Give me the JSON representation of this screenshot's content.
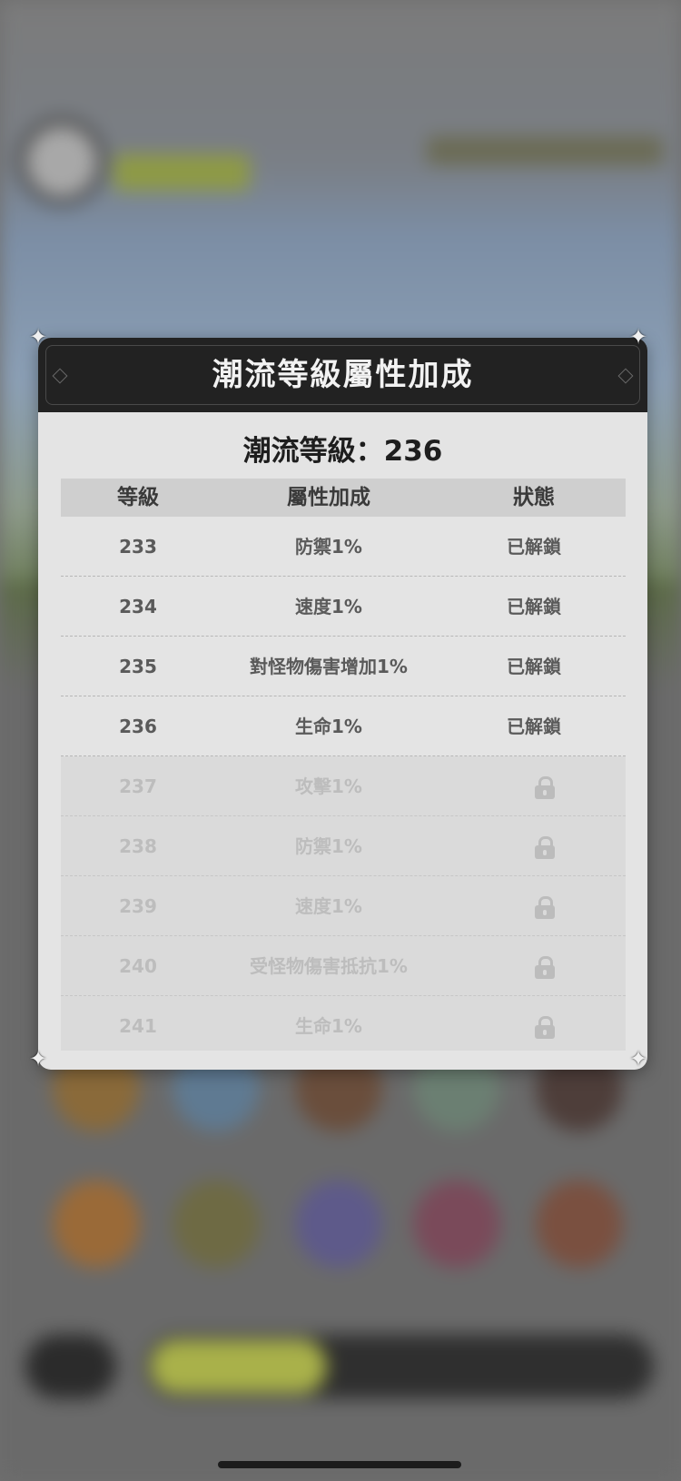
{
  "dialog": {
    "title": "潮流等級屬性加成",
    "current_level": "潮流等級：236"
  },
  "table": {
    "headers": [
      "等級",
      "屬性加成",
      "狀態"
    ],
    "rows": [
      {
        "level": "233",
        "attr": "防禦1%",
        "status": "已解鎖",
        "locked": false
      },
      {
        "level": "234",
        "attr": "速度1%",
        "status": "已解鎖",
        "locked": false
      },
      {
        "level": "235",
        "attr": "對怪物傷害增加1%",
        "status": "已解鎖",
        "locked": false
      },
      {
        "level": "236",
        "attr": "生命1%",
        "status": "已解鎖",
        "locked": false
      },
      {
        "level": "237",
        "attr": "攻擊1%",
        "status": "",
        "locked": true
      },
      {
        "level": "238",
        "attr": "防禦1%",
        "status": "",
        "locked": true
      },
      {
        "level": "239",
        "attr": "速度1%",
        "status": "",
        "locked": true
      },
      {
        "level": "240",
        "attr": "受怪物傷害抵抗1%",
        "status": "",
        "locked": true
      },
      {
        "level": "241",
        "attr": "生命1%",
        "status": "",
        "locked": true
      }
    ]
  },
  "icons": {
    "corner": "corner-ornament-icon",
    "locked_status": "lock-icon"
  },
  "colors": {
    "header_bg": "#222222",
    "dialog_bg": "#e4e4e4",
    "locked_row_bg": "#dadada"
  }
}
